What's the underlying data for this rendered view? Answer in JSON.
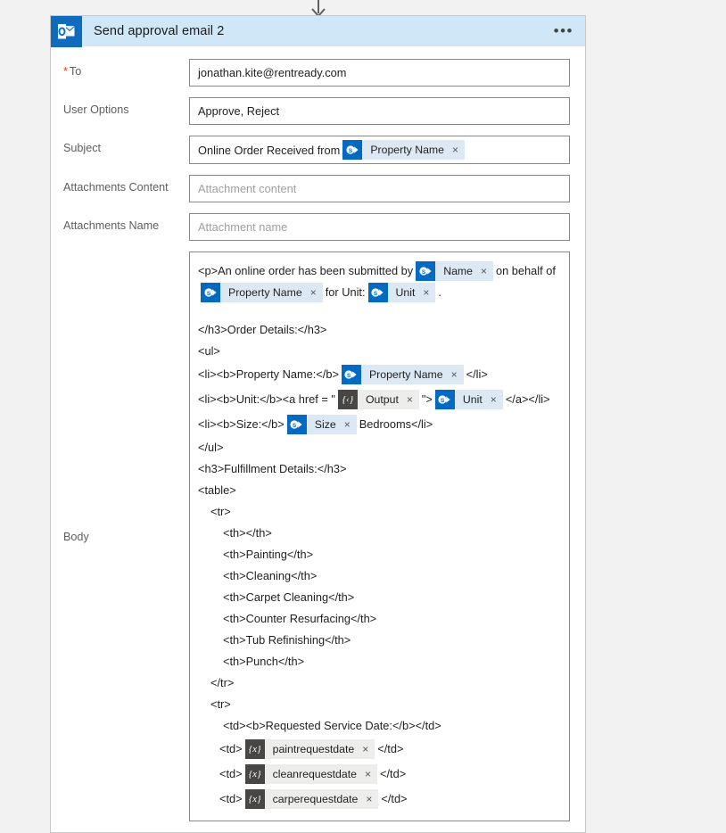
{
  "connector": {
    "icon": "down-arrow-icon"
  },
  "card": {
    "header": {
      "icon": "outlook-icon",
      "title": "Send approval email 2",
      "more_label": "•••"
    },
    "fields": [
      {
        "label": "To",
        "required": true,
        "value": "jonathan.kite@rentready.com",
        "placeholder": ""
      },
      {
        "label": "User Options",
        "required": false,
        "value": "Approve, Reject",
        "placeholder": ""
      },
      {
        "label": "Attachments Content",
        "required": false,
        "value": "",
        "placeholder": "Attachment content"
      },
      {
        "label": "Attachments Name",
        "required": false,
        "value": "",
        "placeholder": "Attachment name"
      }
    ],
    "subject": {
      "label": "Subject",
      "text": "Online Order Received from",
      "token": {
        "kind": "sharepoint",
        "label": "Property Name",
        "remove": "×"
      }
    },
    "body": {
      "label": "Body",
      "lines": [
        {
          "indent": 0,
          "parts": [
            {
              "type": "text",
              "value": "<p>An online order has been submitted by"
            },
            {
              "type": "token",
              "kind": "sharepoint",
              "label": "Name"
            },
            {
              "type": "text",
              "value": "on behalf of"
            },
            {
              "type": "token",
              "kind": "sharepoint",
              "label": "Property Name"
            },
            {
              "type": "text",
              "value": "for Unit:"
            },
            {
              "type": "token",
              "kind": "sharepoint",
              "label": "Unit"
            },
            {
              "type": "text",
              "value": "."
            }
          ]
        },
        {
          "indent": 0,
          "blank": true,
          "parts": []
        },
        {
          "indent": 0,
          "parts": [
            {
              "type": "text",
              "value": "</h3>Order Details:</h3>"
            }
          ]
        },
        {
          "indent": 0,
          "parts": [
            {
              "type": "text",
              "value": "<ul>"
            }
          ]
        },
        {
          "indent": 0,
          "parts": [
            {
              "type": "text",
              "value": "<li><b>Property Name:</b>"
            },
            {
              "type": "token",
              "kind": "sharepoint",
              "label": "Property Name"
            },
            {
              "type": "text",
              "value": "</li>"
            }
          ]
        },
        {
          "indent": 0,
          "parts": [
            {
              "type": "text",
              "value": "<li><b>Unit:</b><a href = \""
            },
            {
              "type": "token",
              "kind": "expression",
              "label": "Output"
            },
            {
              "type": "text",
              "value": "\">"
            },
            {
              "type": "token",
              "kind": "sharepoint",
              "label": "Unit"
            },
            {
              "type": "text",
              "value": "</a></li>"
            }
          ]
        },
        {
          "indent": 0,
          "parts": [
            {
              "type": "text",
              "value": "<li><b>Size:</b>"
            },
            {
              "type": "token",
              "kind": "sharepoint",
              "label": "Size"
            },
            {
              "type": "text",
              "value": "Bedrooms</li>"
            }
          ]
        },
        {
          "indent": 0,
          "parts": [
            {
              "type": "text",
              "value": "</ul>"
            }
          ]
        },
        {
          "indent": 0,
          "parts": [
            {
              "type": "text",
              "value": "<h3>Fulfillment Details:</h3>"
            }
          ]
        },
        {
          "indent": 0,
          "parts": [
            {
              "type": "text",
              "value": "<table>"
            }
          ]
        },
        {
          "indent": 1,
          "parts": [
            {
              "type": "text",
              "value": "<tr>"
            }
          ]
        },
        {
          "indent": 2,
          "parts": [
            {
              "type": "text",
              "value": "<th></th>"
            }
          ]
        },
        {
          "indent": 2,
          "parts": [
            {
              "type": "text",
              "value": "<th>Painting</th>"
            }
          ]
        },
        {
          "indent": 2,
          "parts": [
            {
              "type": "text",
              "value": "<th>Cleaning</th>"
            }
          ]
        },
        {
          "indent": 2,
          "parts": [
            {
              "type": "text",
              "value": "<th>Carpet Cleaning</th>"
            }
          ]
        },
        {
          "indent": 2,
          "parts": [
            {
              "type": "text",
              "value": "<th>Counter Resurfacing</th>"
            }
          ]
        },
        {
          "indent": 2,
          "parts": [
            {
              "type": "text",
              "value": "<th>Tub Refinishing</th>"
            }
          ]
        },
        {
          "indent": 2,
          "parts": [
            {
              "type": "text",
              "value": "<th>Punch</th>"
            }
          ]
        },
        {
          "indent": 1,
          "parts": [
            {
              "type": "text",
              "value": "</tr>"
            }
          ]
        },
        {
          "indent": 1,
          "parts": [
            {
              "type": "text",
              "value": "<tr>"
            }
          ]
        },
        {
          "indent": 2,
          "parts": [
            {
              "type": "text",
              "value": "<td><b>Requested Service Date:</b></td>"
            }
          ]
        },
        {
          "indent": 3,
          "parts": [
            {
              "type": "text",
              "value": "<td>"
            },
            {
              "type": "token",
              "kind": "variable",
              "label": "paintrequestdate"
            },
            {
              "type": "text",
              "value": "</td>"
            }
          ]
        },
        {
          "indent": 3,
          "parts": [
            {
              "type": "text",
              "value": "<td>"
            },
            {
              "type": "token",
              "kind": "variable",
              "label": "cleanrequestdate"
            },
            {
              "type": "text",
              "value": "</td>"
            }
          ]
        },
        {
          "indent": 3,
          "parts": [
            {
              "type": "text",
              "value": "<td>"
            },
            {
              "type": "token",
              "kind": "variable",
              "label": "carperequestdate"
            },
            {
              "type": "text",
              "value": "</td>"
            }
          ]
        }
      ]
    }
  },
  "glyphs": {
    "remove": "×",
    "expression": "{‹}",
    "variable": "{x}"
  },
  "colors": {
    "page_bg": "#f2f2f2",
    "header_bg": "#cfe7f7",
    "outlook_blue": "#0f6cbd",
    "sharepoint_blue": "#036ac4",
    "sharepoint_chip_bg": "#dce9f5",
    "token_dark": "#484644",
    "token_grey_bg": "#ededeb",
    "required_red": "#d83b01",
    "label_grey": "#605e5c"
  }
}
